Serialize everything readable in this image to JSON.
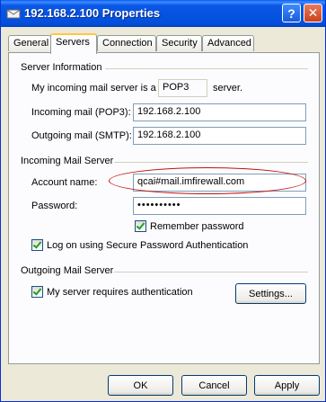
{
  "window": {
    "title": "192.168.2.100 Properties"
  },
  "tabs": [
    {
      "label": "General"
    },
    {
      "label": "Servers"
    },
    {
      "label": "Connection"
    },
    {
      "label": "Security"
    },
    {
      "label": "Advanced"
    }
  ],
  "active_tab": "Servers",
  "server_info": {
    "group_label": "Server Information",
    "incoming_type_prefix": "My incoming mail server is a",
    "incoming_type_value": "POP3",
    "incoming_type_suffix": "server.",
    "incoming_label": "Incoming mail (POP3):",
    "incoming_value": "192.168.2.100",
    "outgoing_label": "Outgoing mail (SMTP):",
    "outgoing_value": "192.168.2.100"
  },
  "incoming_server": {
    "group_label": "Incoming Mail Server",
    "account_label": "Account name:",
    "account_value": "qcai#mail.imfirewall.com",
    "password_label": "Password:",
    "password_value": "••••••••••",
    "remember_label": "Remember password",
    "remember_checked": true,
    "spa_label": "Log on using Secure Password Authentication",
    "spa_checked": true
  },
  "outgoing_server": {
    "group_label": "Outgoing Mail Server",
    "auth_label": "My server requires authentication",
    "auth_checked": true,
    "settings_label": "Settings..."
  },
  "buttons": {
    "ok": "OK",
    "cancel": "Cancel",
    "apply": "Apply"
  },
  "colors": {
    "titlebar": "#0452de",
    "annotation": "#c0140f",
    "dialog_bg": "#ece9d8"
  }
}
